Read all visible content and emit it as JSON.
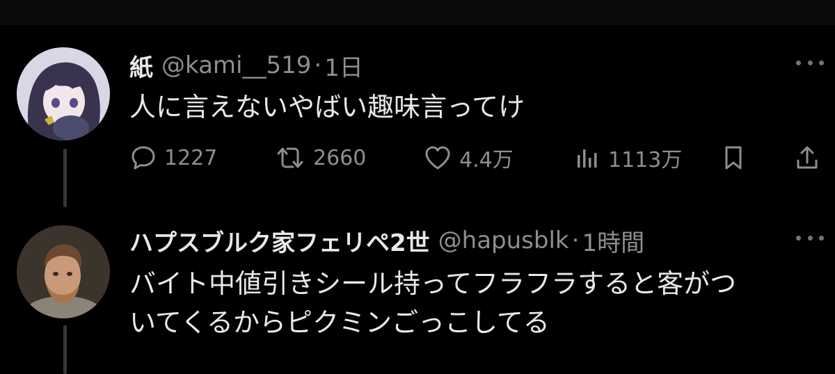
{
  "tweets": [
    {
      "name": "紙",
      "handle": "@kami__519",
      "separator": "·",
      "time": "1日",
      "text_lines": [
        "人に言えないやばい趣味言ってけ"
      ],
      "stats": {
        "replies": "1227",
        "retweets": "2660",
        "likes": "4.4万",
        "views": "1113万"
      }
    },
    {
      "name": "ハプスブルク家フェリペ2世",
      "handle": "@hapusblk",
      "separator": "·",
      "time": "1時間",
      "text_lines": [
        "バイト中値引きシール持ってフラフラすると客がつ",
        "いてくるからピクミンごっこしてる"
      ]
    }
  ],
  "icons": {
    "reply": "speech-bubble-icon",
    "retweet": "retweet-arrows-icon",
    "like": "heart-icon",
    "views": "bar-chart-icon",
    "bookmark": "bookmark-icon",
    "share": "share-upload-icon",
    "more": "more-horizontal-icon"
  },
  "colors": {
    "background": "#000000",
    "primary_text": "#e7e9ea",
    "secondary_text": "#8b8f94",
    "thread_line": "#333639"
  }
}
